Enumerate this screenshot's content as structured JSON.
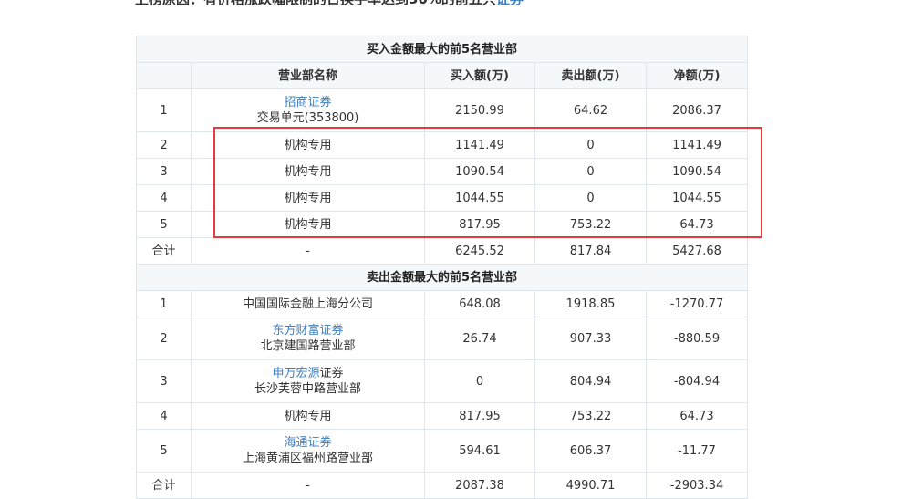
{
  "top_text": {
    "prefix": "上榜原因：有价格涨跌幅限制的日换手率达到30%的前五只",
    "link": "证券"
  },
  "columns": [
    "营业部名称",
    "买入额(万)",
    "卖出额(万)",
    "净额(万)"
  ],
  "buy_section": {
    "title": "买入金额最大的前5名营业部",
    "rows": [
      {
        "idx": "1",
        "broker_link": "招商证券",
        "broker_link_tail": "",
        "branch": "交易单元(353800)",
        "buy": "2150.99",
        "sell": "64.62",
        "net": "2086.37"
      },
      {
        "idx": "2",
        "broker_link": "",
        "broker_link_tail": "",
        "branch": "机构专用",
        "buy": "1141.49",
        "sell": "0",
        "net": "1141.49"
      },
      {
        "idx": "3",
        "broker_link": "",
        "broker_link_tail": "",
        "branch": "机构专用",
        "buy": "1090.54",
        "sell": "0",
        "net": "1090.54"
      },
      {
        "idx": "4",
        "broker_link": "",
        "broker_link_tail": "",
        "branch": "机构专用",
        "buy": "1044.55",
        "sell": "0",
        "net": "1044.55"
      },
      {
        "idx": "5",
        "broker_link": "",
        "broker_link_tail": "",
        "branch": "机构专用",
        "buy": "817.95",
        "sell": "753.22",
        "net": "64.73"
      }
    ],
    "total": {
      "label": "合计",
      "name": "-",
      "buy": "6245.52",
      "sell": "817.84",
      "net": "5427.68"
    }
  },
  "sell_section": {
    "title": "卖出金额最大的前5名营业部",
    "rows": [
      {
        "idx": "1",
        "broker_link": "",
        "broker_link_tail": "",
        "branch": "中国国际金融上海分公司",
        "buy": "648.08",
        "sell": "1918.85",
        "net": "-1270.77"
      },
      {
        "idx": "2",
        "broker_link": "东方财富证券",
        "broker_link_tail": "",
        "branch": "北京建国路营业部",
        "buy": "26.74",
        "sell": "907.33",
        "net": "-880.59"
      },
      {
        "idx": "3",
        "broker_link": "申万宏源",
        "broker_link_tail": "证券",
        "branch": "长沙芙蓉中路营业部",
        "buy": "0",
        "sell": "804.94",
        "net": "-804.94"
      },
      {
        "idx": "4",
        "broker_link": "",
        "broker_link_tail": "",
        "branch": "机构专用",
        "buy": "817.95",
        "sell": "753.22",
        "net": "64.73"
      },
      {
        "idx": "5",
        "broker_link": "海通证券",
        "broker_link_tail": "",
        "branch": "上海黄浦区福州路营业部",
        "buy": "594.61",
        "sell": "606.37",
        "net": "-11.77"
      }
    ],
    "total": {
      "label": "合计",
      "name": "-",
      "buy": "2087.38",
      "sell": "4990.71",
      "net": "-2903.34"
    }
  },
  "highlight_color": "#e8393d",
  "link_color": "#3b7fc4"
}
